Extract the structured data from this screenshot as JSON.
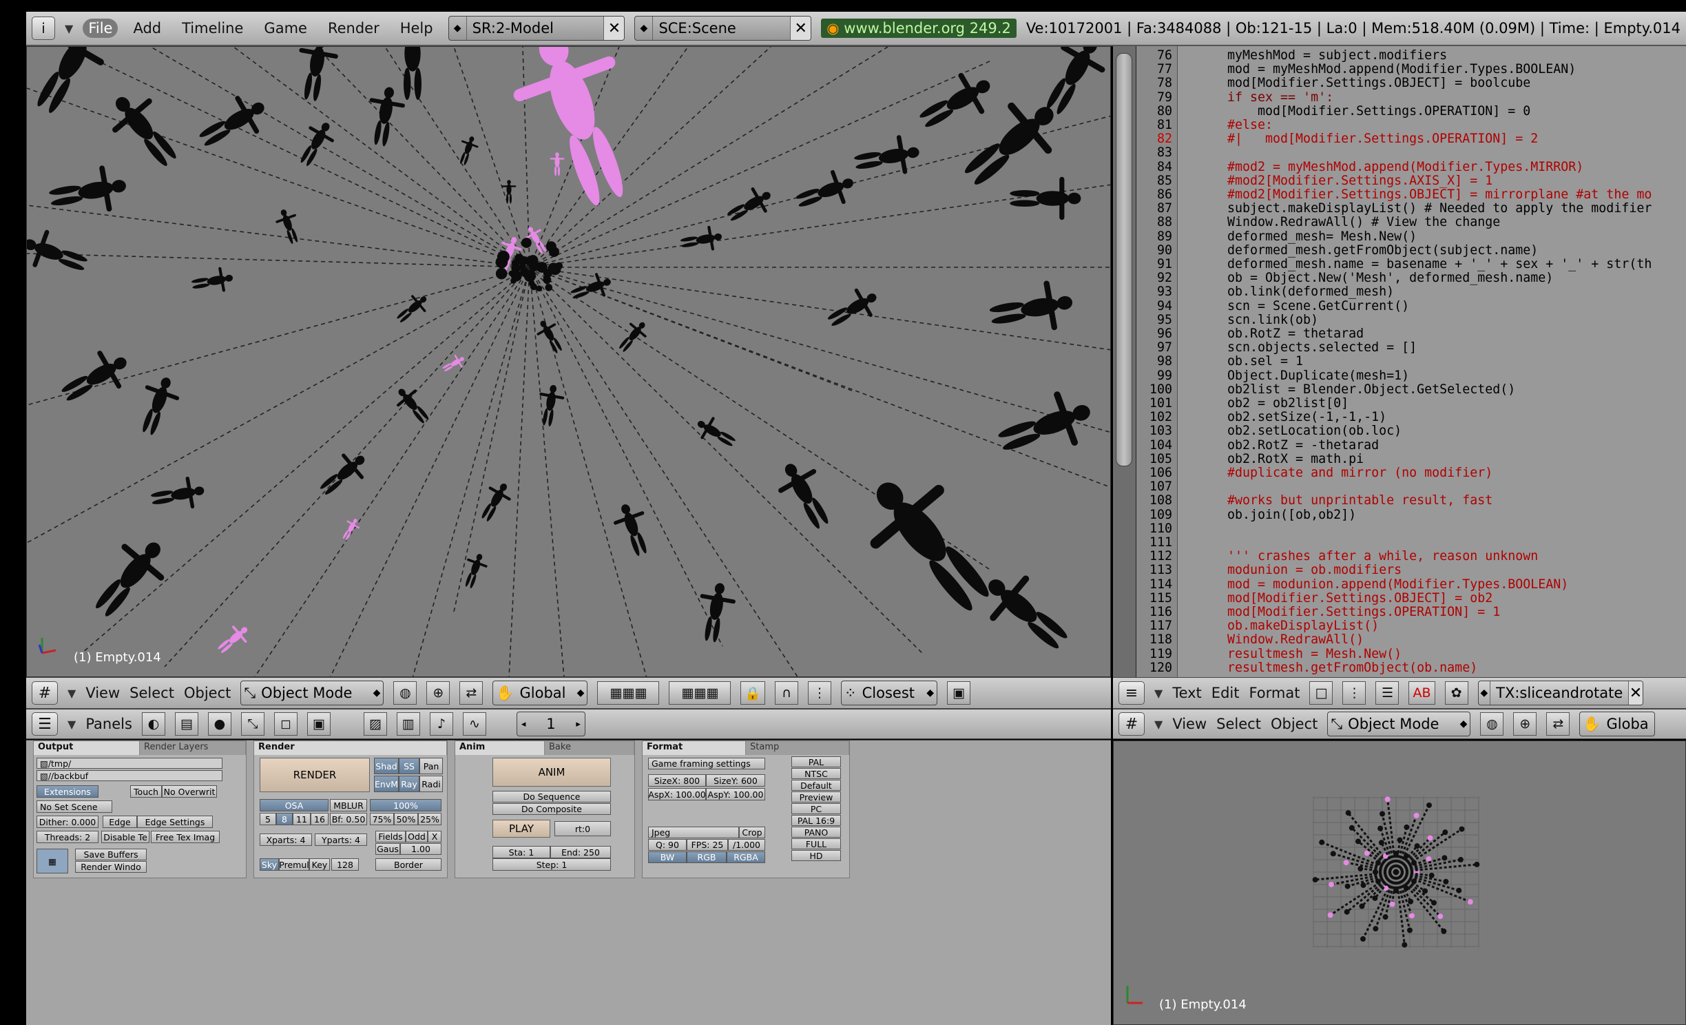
{
  "topbar": {
    "info_icon": "i",
    "menus": [
      "File",
      "Add",
      "Timeline",
      "Game",
      "Render",
      "Help"
    ],
    "screen": "SR:2-Model",
    "scene": "SCE:Scene",
    "url": "www.blender.org 249.2",
    "stats": "Ve:10172001 | Fa:3484088 | Ob:121-15 | La:0 | Mem:518.40M (0.09M) | Time: | Empty.014"
  },
  "viewport": {
    "label": "(1) Empty.014",
    "header": {
      "menus": [
        "View",
        "Select",
        "Object"
      ],
      "mode": "Object Mode",
      "orientation": "Global",
      "snap": "Closest"
    }
  },
  "editor": {
    "header": {
      "menus": [
        "Text",
        "Edit",
        "Format"
      ],
      "textname": "TX:sliceandrotate"
    },
    "lines": [
      {
        "n": "76",
        "t": "myMeshMod = subject.modifiers",
        "s": "n"
      },
      {
        "n": "77",
        "t": "mod = myMeshMod.append(Modifier.Types.BOOLEAN)",
        "s": "n"
      },
      {
        "n": "78",
        "t": "mod[Modifier.Settings.OBJECT] = boolcube",
        "s": "n"
      },
      {
        "n": "79",
        "t": "if sex == 'm':",
        "s": "k"
      },
      {
        "n": "80",
        "t": "    mod[Modifier.Settings.OPERATION] = 0",
        "s": "n"
      },
      {
        "n": "81",
        "t": "#else:",
        "s": "c"
      },
      {
        "n": "82",
        "t": "#|   mod[Modifier.Settings.OPERATION] = 2",
        "s": "c",
        "err": true
      },
      {
        "n": "83",
        "t": "",
        "s": "n"
      },
      {
        "n": "84",
        "t": "#mod2 = myMeshMod.append(Modifier.Types.MIRROR)",
        "s": "c"
      },
      {
        "n": "85",
        "t": "#mod2[Modifier.Settings.AXIS_X] = 1",
        "s": "c"
      },
      {
        "n": "86",
        "t": "#mod2[Modifier.Settings.OBJECT] = mirrorplane #at the mo",
        "s": "c"
      },
      {
        "n": "87",
        "t": "subject.makeDisplayList() # Needed to apply the modifier",
        "s": "n"
      },
      {
        "n": "88",
        "t": "Window.RedrawAll() # View the change",
        "s": "n"
      },
      {
        "n": "89",
        "t": "deformed_mesh= Mesh.New()",
        "s": "n"
      },
      {
        "n": "90",
        "t": "deformed_mesh.getFromObject(subject.name)",
        "s": "n"
      },
      {
        "n": "91",
        "t": "deformed_mesh.name = basename + '_' + sex + '_' + str(th",
        "s": "n"
      },
      {
        "n": "92",
        "t": "ob = Object.New('Mesh', deformed_mesh.name)",
        "s": "n"
      },
      {
        "n": "93",
        "t": "ob.link(deformed_mesh)",
        "s": "n"
      },
      {
        "n": "94",
        "t": "scn = Scene.GetCurrent()",
        "s": "n"
      },
      {
        "n": "95",
        "t": "scn.link(ob)",
        "s": "n"
      },
      {
        "n": "96",
        "t": "ob.RotZ = thetarad",
        "s": "n"
      },
      {
        "n": "97",
        "t": "scn.objects.selected = []",
        "s": "n"
      },
      {
        "n": "98",
        "t": "ob.sel = 1",
        "s": "n"
      },
      {
        "n": "99",
        "t": "Object.Duplicate(mesh=1)",
        "s": "n"
      },
      {
        "n": "100",
        "t": "ob2list = Blender.Object.GetSelected()",
        "s": "n"
      },
      {
        "n": "101",
        "t": "ob2 = ob2list[0]",
        "s": "n"
      },
      {
        "n": "102",
        "t": "ob2.setSize(-1,-1,-1)",
        "s": "n"
      },
      {
        "n": "103",
        "t": "ob2.setLocation(ob.loc)",
        "s": "n"
      },
      {
        "n": "104",
        "t": "ob2.RotZ = -thetarad",
        "s": "n"
      },
      {
        "n": "105",
        "t": "ob2.RotX = math.pi",
        "s": "n"
      },
      {
        "n": "106",
        "t": "#duplicate and mirror (no modifier)",
        "s": "c"
      },
      {
        "n": "107",
        "t": "",
        "s": "n"
      },
      {
        "n": "108",
        "t": "#works but unprintable result, fast",
        "s": "c"
      },
      {
        "n": "109",
        "t": "ob.join([ob,ob2])",
        "s": "n"
      },
      {
        "n": "110",
        "t": "",
        "s": "n"
      },
      {
        "n": "111",
        "t": "",
        "s": "n"
      },
      {
        "n": "112",
        "t": "''' crashes after a while, reason unknown",
        "s": "c"
      },
      {
        "n": "113",
        "t": "modunion = ob.modifiers",
        "s": "c"
      },
      {
        "n": "114",
        "t": "mod = modunion.append(Modifier.Types.BOOLEAN)",
        "s": "c"
      },
      {
        "n": "115",
        "t": "mod[Modifier.Settings.OBJECT] = ob2",
        "s": "c"
      },
      {
        "n": "116",
        "t": "mod[Modifier.Settings.OPERATION] = 1",
        "s": "c"
      },
      {
        "n": "117",
        "t": "ob.makeDisplayList()",
        "s": "c"
      },
      {
        "n": "118",
        "t": "Window.RedrawAll()",
        "s": "c"
      },
      {
        "n": "119",
        "t": "resultmesh = Mesh.New()",
        "s": "c"
      },
      {
        "n": "120",
        "t": "resultmesh.getFromObject(ob.name)",
        "s": "c"
      }
    ]
  },
  "buttons": {
    "header": {
      "panels_label": "Panels",
      "frame": "1"
    },
    "output": {
      "tabs": [
        "Output",
        "Render Layers"
      ],
      "path1": "/tmp/",
      "path2": "//backbuf",
      "extensions": "Extensions",
      "touch": "Touch",
      "no_overwrite": "No Overwrit",
      "no_set_scene": "No Set Scene",
      "dither": "Dither: 0.000",
      "edge": "Edge",
      "edge_settings": "Edge Settings",
      "threads": "Threads: 2",
      "disable_tex": "Disable Te",
      "free_tex": "Free Tex Imag",
      "save_buffers": "Save Buffers",
      "render_window": "Render Windo"
    },
    "render": {
      "tab": "Render",
      "render_btn": "RENDER",
      "shad": "Shad",
      "ss": "SS",
      "pan": "Pan",
      "envmap": "EnvM",
      "ray": "Ray",
      "radio": "Radi",
      "osa": "OSA",
      "mblur": "MBLUR",
      "pct100": "100%",
      "osa_vals": [
        "5",
        "8",
        "11",
        "16"
      ],
      "bf": "Bf: 0.50",
      "pcts": [
        "75%",
        "50%",
        "25%"
      ],
      "xparts": "Xparts: 4",
      "yparts": "Yparts: 4",
      "fields": "Fields",
      "odd": "Odd",
      "x": "X",
      "gauss": "Gaus",
      "gauss_val": "1.00",
      "sky": "Sky",
      "premul": "Premul",
      "key": "Key",
      "bits": "128",
      "border": "Border"
    },
    "anim": {
      "tabs": [
        "Anim",
        "Bake"
      ],
      "anim_btn": "ANIM",
      "do_seq": "Do Sequence",
      "do_comp": "Do Composite",
      "play": "PLAY",
      "rt": "rt:0",
      "sta": "Sta: 1",
      "end": "End: 250",
      "step": "Step: 1"
    },
    "format": {
      "tabs": [
        "Format",
        "Stamp"
      ],
      "framing": "Game framing settings",
      "sizex": "SizeX: 800",
      "sizey": "SizeY: 600",
      "aspx": "AspX: 100.00",
      "aspy": "AspY: 100.00",
      "presets": [
        "PAL",
        "NTSC",
        "Default",
        "Preview",
        "PC",
        "PAL 16:9",
        "PANO",
        "FULL",
        "HD"
      ],
      "fmt": "Jpeg",
      "crop": "Crop",
      "quality": "Q: 90",
      "fps": "FPS: 25",
      "fpsb": "/1.000",
      "bw": "BW",
      "rgb": "RGB",
      "rgba": "RGBA"
    }
  },
  "rightview": {
    "label": "(1) Empty.014",
    "header": {
      "menus": [
        "View",
        "Select",
        "Object"
      ],
      "mode": "Object Mode",
      "orientation": "Globa"
    }
  }
}
